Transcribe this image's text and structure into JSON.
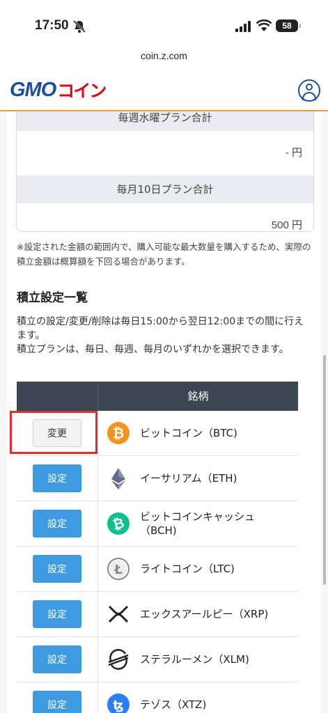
{
  "status_bar": {
    "time": "17:50",
    "battery": "58"
  },
  "browser": {
    "url": "coin.z.com"
  },
  "header": {
    "logo_gmo": "GMO",
    "logo_coin": "コイン"
  },
  "summary": {
    "weekly_wed_label": "毎週水曜プラン合計",
    "weekly_wed_value": "- 円",
    "monthly_10_label": "毎月10日プラン合計",
    "monthly_10_value": "500 円"
  },
  "note": "※設定された金額の範囲内で、購入可能な最大数量を購入するため、実際の積立金額は概算額を下回る場合があります。",
  "section": {
    "title": "積立設定一覧",
    "desc_line1": "積立の設定/変更/削除は毎日15:00から翌日12:00までの間に行えます。",
    "desc_line2": "積立プランは、毎日、毎週、毎月のいずれかを選択できます。"
  },
  "table": {
    "header_col2": "銘柄",
    "rows": [
      {
        "action": "変更",
        "name": "ビットコイン（BTC)",
        "icon": "bitcoin-icon"
      },
      {
        "action": "設定",
        "name": "イーサリアム（ETH)",
        "icon": "ethereum-icon"
      },
      {
        "action": "設定",
        "name": "ビットコインキャッシュ（BCH)",
        "icon": "bitcoin-cash-icon"
      },
      {
        "action": "設定",
        "name": "ライトコイン（LTC)",
        "icon": "litecoin-icon"
      },
      {
        "action": "設定",
        "name": "エックスアールピー（XRP)",
        "icon": "xrp-icon"
      },
      {
        "action": "設定",
        "name": "ステラルーメン（XLM)",
        "icon": "stellar-icon"
      },
      {
        "action": "設定",
        "name": "テゾス（XTZ)",
        "icon": "tezos-icon"
      }
    ]
  },
  "colors": {
    "accent": "#3d9ae0",
    "header_line": "#e8a13a",
    "highlight": "#e52d2d",
    "table_head": "#3b4652"
  }
}
